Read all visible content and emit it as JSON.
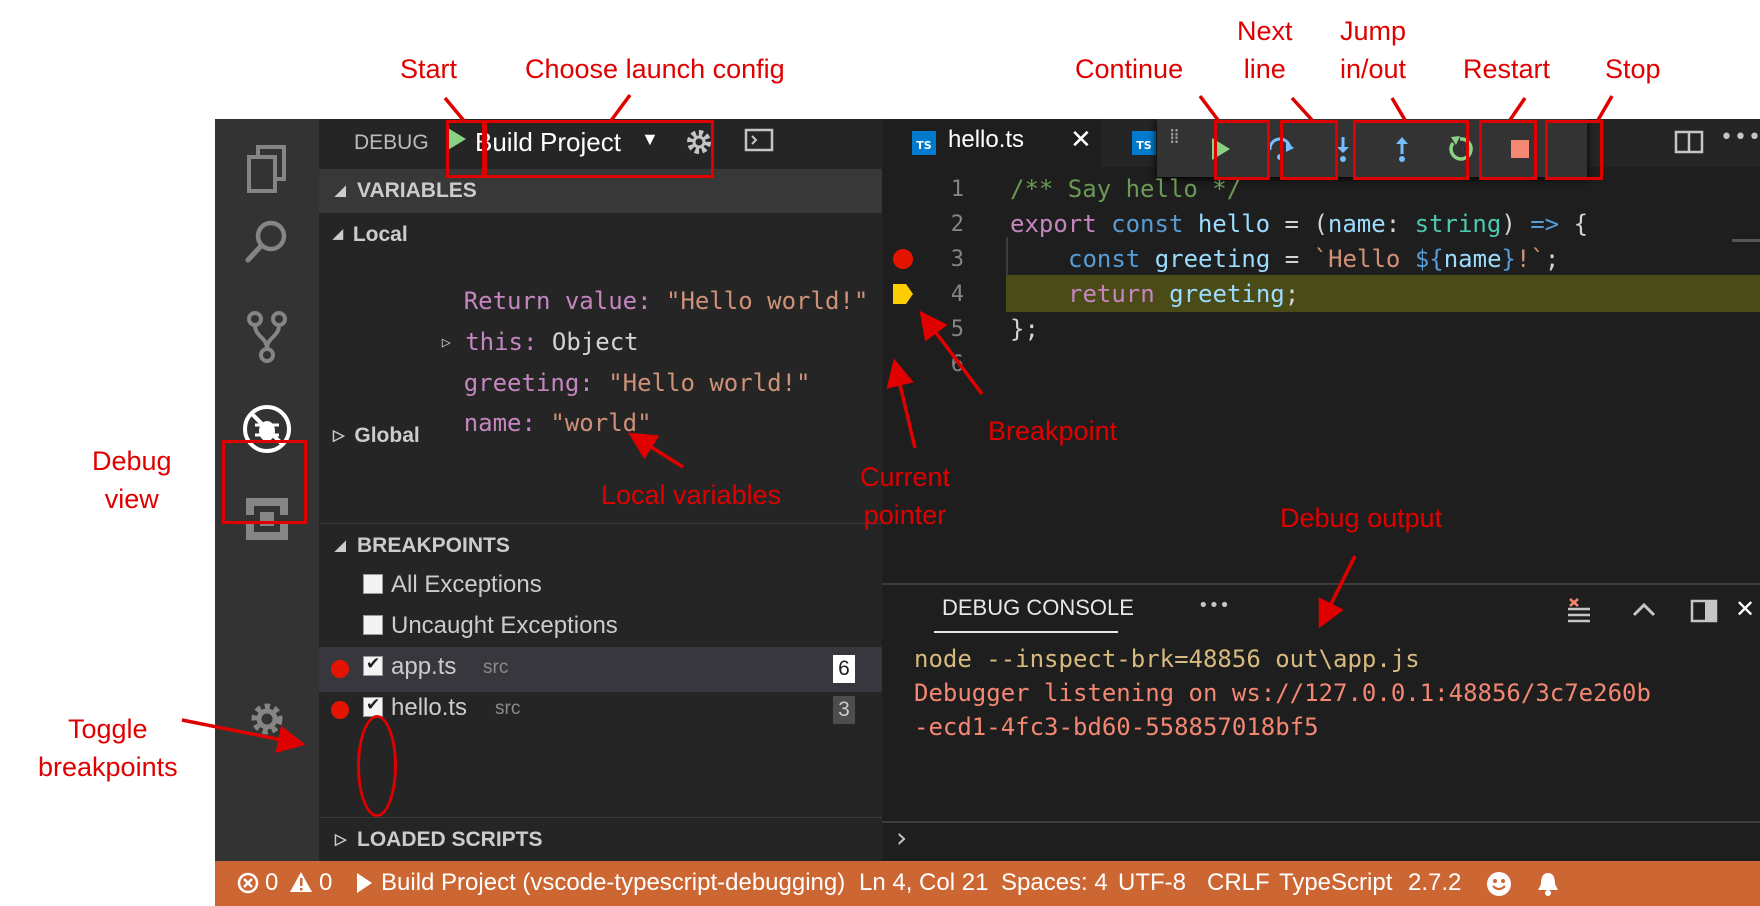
{
  "sidebar": {
    "title": "DEBUG",
    "launch_config": "Build Project",
    "variables_header": "VARIABLES",
    "local_label": "Local",
    "variables": [
      {
        "name": "Return value:",
        "value": "\"Hello world!\""
      },
      {
        "name": "this:",
        "value": "Object"
      },
      {
        "name": "greeting:",
        "value": "\"Hello world!\""
      },
      {
        "name": "name:",
        "value": "\"world\""
      }
    ],
    "global_label": "Global",
    "breakpoints_header": "BREAKPOINTS",
    "breakpoints": [
      {
        "label": "All Exceptions",
        "path": "",
        "line": ""
      },
      {
        "label": "Uncaught Exceptions",
        "path": "",
        "line": ""
      },
      {
        "label": "app.ts",
        "path": "src",
        "line": "6"
      },
      {
        "label": "hello.ts",
        "path": "src",
        "line": "3"
      }
    ],
    "loaded_scripts_header": "LOADED SCRIPTS"
  },
  "editor": {
    "tab_label": "hello.ts",
    "tab_icon_text": "TS",
    "line_numbers": [
      "1",
      "2",
      "3",
      "4",
      "5",
      "6"
    ],
    "code": {
      "l1": "/** Say hello */",
      "l2_export": "export",
      "l2_const": "const",
      "l2_name": "hello",
      "l2_eq": " = (",
      "l2_param": "name",
      "l2_colon": ": ",
      "l2_type": "string",
      "l2_paren": ") ",
      "l2_arrow": "=>",
      "l2_brace": " {",
      "l3_const": "const",
      "l3_var": "greeting",
      "l3_eq": " = ",
      "l3_str1": "`Hello ",
      "l3_interp_open": "${",
      "l3_interp_var": "name",
      "l3_interp_close": "}",
      "l3_str2": "!`",
      "l3_semi": ";",
      "l4_return": "return",
      "l4_var": "greeting",
      "l4_semi": ";",
      "l5": "};"
    }
  },
  "panel": {
    "tab_label": "DEBUG CONSOLE",
    "more": "•••",
    "output": [
      "node --inspect-brk=48856 out\\app.js",
      "Debugger listening on ws://127.0.0.1:48856/3c7e260b",
      "-ecd1-4fc3-bd60-558857018bf5"
    ],
    "prompt": "›"
  },
  "status": {
    "errors": "0",
    "warnings": "0",
    "run_label": "Build Project (vscode-typescript-debugging)",
    "position": "Ln 4, Col 21",
    "spaces": "Spaces: 4",
    "encoding": "UTF-8",
    "eol": "CRLF",
    "language": "TypeScript",
    "version": "2.7.2"
  },
  "annotations": {
    "start": "Start",
    "choose_config": "Choose launch config",
    "continue": "Continue",
    "next_line": "Next\nline",
    "jump": "Jump\nin/out",
    "restart": "Restart",
    "stop": "Stop",
    "debug_view": "Debug\nview",
    "local_variables": "Local variables",
    "breakpoint": "Breakpoint",
    "current_pointer": "Current\npointer",
    "debug_output": "Debug output",
    "toggle_breakpoints": "Toggle\nbreakpoints"
  },
  "colors": {
    "status_bar": "#cc6633",
    "annotation": "#e00000",
    "current_line": "#4b4b18"
  }
}
